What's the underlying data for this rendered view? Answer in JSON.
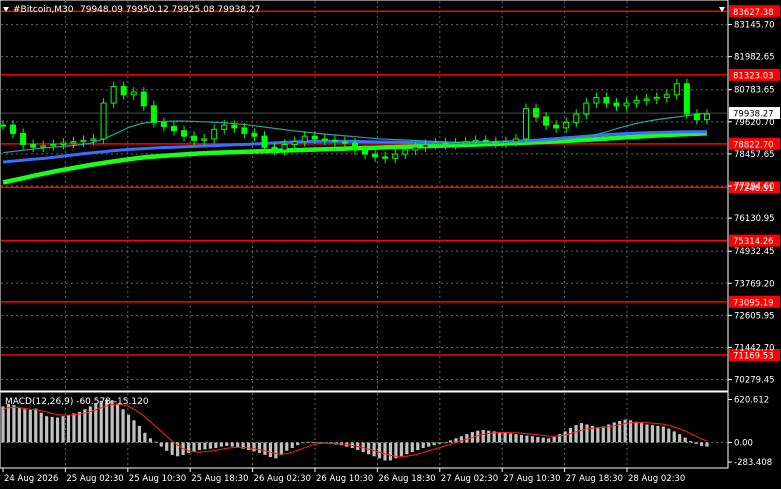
{
  "header": {
    "symbol": "#Bitcoin,M30",
    "ohlc": "79948.09 79950.12 79925.08 79938.27"
  },
  "colors": {
    "background": "#000000",
    "grid": "#5a6c5a",
    "axis_text": "#ffffff",
    "level_line": "#ff0000",
    "level_label_bg": "#ff0000",
    "candle": "#00ff00",
    "ma_fast": "#2aa0a0",
    "ma_mid": "#3b6cff",
    "ma_slow": "#19ff19",
    "macd_hist": "#c0c0c0",
    "macd_signal": "#ff2020",
    "price_label_bg": "#ffffff"
  },
  "chart_data": [
    {
      "type": "line",
      "panel": "price",
      "ylim": [
        69900,
        84000
      ],
      "y_ticks": [
        83145.7,
        81982.65,
        80783.65,
        79620.7,
        78457.65,
        77294.6,
        76130.95,
        74932.45,
        73769.2,
        72605.95,
        71442.7,
        70279.45
      ],
      "y_tick_labels": [
        "83145.70",
        "81982.65",
        "80783.65",
        "79620.70",
        "78457.65",
        "77294.60",
        "76130.95",
        "74932.45",
        "73769.20",
        "72605.95",
        "71442.70",
        "70279.45"
      ],
      "x_labels": [
        "24 Aug 2026",
        "25 Aug 02:30",
        "25 Aug 10:30",
        "25 Aug 18:30",
        "26 Aug 02:30",
        "26 Aug 10:30",
        "26 Aug 18:30",
        "27 Aug 02:30",
        "27 Aug 10:30",
        "27 Aug 18:30",
        "28 Aug 02:30"
      ],
      "levels": [
        {
          "value": 83627.38,
          "label": "83627.38"
        },
        {
          "value": 81323.03,
          "label": "81323.03"
        },
        {
          "value": 78822.7,
          "label": "78822.70"
        },
        {
          "value": 77246.51,
          "label": "77246.51"
        },
        {
          "value": 75314.26,
          "label": "75314.26"
        },
        {
          "value": 73095.19,
          "label": "73095.19"
        },
        {
          "value": 71169.53,
          "label": "71169.53"
        }
      ],
      "current_price": {
        "value": 79938.27,
        "label": "79938.27"
      },
      "price_series": [
        79500,
        79200,
        78800,
        78700,
        78750,
        78800,
        78850,
        78900,
        78950,
        79000,
        80300,
        80900,
        80600,
        80700,
        80200,
        79600,
        79450,
        79300,
        79100,
        78950,
        79000,
        79350,
        79500,
        79400,
        79200,
        79100,
        78700,
        78600,
        78800,
        78900,
        79100,
        79000,
        78950,
        78900,
        78850,
        78600,
        78450,
        78350,
        78300,
        78450,
        78600,
        78700,
        78800,
        78850,
        78800,
        78850,
        78900,
        78950,
        78900,
        78850,
        78900,
        79000,
        80100,
        79800,
        79500,
        79400,
        79600,
        79900,
        80300,
        80500,
        80300,
        80200,
        80300,
        80400,
        80450,
        80500,
        80600,
        81000,
        79900,
        79700,
        79900
      ],
      "series": [
        {
          "values": [
            78500,
            78560,
            78610,
            78660,
            78700,
            78740,
            78780,
            78850,
            79000,
            79200,
            79420,
            79560,
            79620,
            79640,
            79650,
            79640,
            79620,
            79600,
            79570,
            79530,
            79480,
            79420,
            79360,
            79300,
            79250,
            79200,
            79160,
            79120,
            79080,
            79040,
            79000,
            78980,
            78960,
            78940,
            78920,
            78900,
            78880,
            78870,
            78860,
            78860,
            78870,
            78880,
            78900,
            78930,
            78960,
            79000,
            79060,
            79140,
            79260,
            79400,
            79520,
            79620,
            79700,
            79760,
            79820,
            79880,
            79930
          ]
        },
        {
          "values": [
            78160,
            78210,
            78260,
            78300,
            78360,
            78420,
            78480,
            78530,
            78580,
            78620,
            78650,
            78680,
            78700,
            78720,
            78740,
            78760,
            78780,
            78800,
            78820,
            78850,
            78880,
            78900,
            78910,
            78915,
            78915,
            78910,
            78900,
            78890,
            78880,
            78870,
            78860,
            78850,
            78850,
            78860,
            78870,
            78880,
            78900,
            78930,
            78960,
            79000,
            79040,
            79080,
            79120,
            79160,
            79190,
            79210,
            79230,
            79245,
            79255,
            79260,
            79265
          ]
        },
        {
          "values": [
            77420,
            77560,
            77700,
            77830,
            77950,
            78060,
            78160,
            78250,
            78330,
            78380,
            78430,
            78470,
            78500,
            78520,
            78540,
            78560,
            78580,
            78600,
            78620,
            78640,
            78660,
            78680,
            78700,
            78720,
            78740,
            78760,
            78780,
            78800,
            78820,
            78845,
            78870,
            78900,
            78930,
            78960,
            79000,
            79040,
            79080,
            79120,
            79150,
            79180,
            79200
          ]
        }
      ]
    },
    {
      "type": "bar",
      "panel": "macd",
      "title": "MACD(12,26,9) -60.578 -15.120",
      "ylim": [
        -340,
        700
      ],
      "y_tick_labels": [
        "620.612",
        "0.00",
        "-283.408"
      ],
      "y_ticks": [
        620.612,
        0,
        -283.408
      ],
      "values": [
        520,
        560,
        540,
        500,
        480,
        470,
        490,
        430,
        380,
        370,
        360,
        380,
        400,
        420,
        440,
        480,
        520,
        560,
        600,
        620,
        610,
        560,
        480,
        400,
        320,
        240,
        140,
        60,
        10,
        -60,
        -120,
        -180,
        -200,
        -180,
        -150,
        -130,
        -110,
        -100,
        -90,
        -80,
        -60,
        -50,
        -60,
        -70,
        -90,
        -110,
        -130,
        -150,
        -180,
        -210,
        -230,
        -180,
        -120,
        -80,
        -40,
        0,
        10,
        5,
        0,
        -10,
        -20,
        -30,
        -40,
        -60,
        -80,
        -110,
        -140,
        -170,
        -200,
        -230,
        -260,
        -260,
        -230,
        -200,
        -170,
        -140,
        -110,
        -80,
        -60,
        -40,
        -20,
        0,
        30,
        60,
        90,
        120,
        150,
        170,
        180,
        170,
        160,
        150,
        140,
        130,
        120,
        110,
        100,
        90,
        80,
        70,
        60,
        80,
        120,
        160,
        210,
        250,
        280,
        260,
        240,
        220,
        230,
        260,
        290,
        310,
        330,
        320,
        300,
        280,
        260,
        250,
        240,
        230,
        200,
        160,
        120,
        70,
        20,
        -20,
        -50,
        -60
      ],
      "signal": [
        480,
        500,
        510,
        500,
        490,
        480,
        475,
        460,
        440,
        420,
        400,
        395,
        395,
        400,
        410,
        425,
        445,
        470,
        500,
        530,
        550,
        555,
        545,
        520,
        480,
        430,
        370,
        300,
        230,
        160,
        90,
        20,
        -40,
        -90,
        -120,
        -135,
        -140,
        -135,
        -125,
        -115,
        -100,
        -85,
        -75,
        -70,
        -72,
        -80,
        -92,
        -105,
        -120,
        -140,
        -160,
        -170,
        -160,
        -140,
        -115,
        -85,
        -55,
        -30,
        -15,
        -10,
        -12,
        -16,
        -22,
        -30,
        -42,
        -58,
        -76,
        -96,
        -118,
        -142,
        -166,
        -186,
        -198,
        -202,
        -198,
        -186,
        -168,
        -146,
        -122,
        -98,
        -74,
        -50,
        -26,
        0,
        24,
        48,
        72,
        96,
        116,
        130,
        140,
        144,
        145,
        143,
        140,
        135,
        128,
        120,
        110,
        100,
        92,
        90,
        95,
        108,
        128,
        152,
        178,
        196,
        206,
        210,
        216,
        226,
        240,
        256,
        272,
        284,
        290,
        290,
        286,
        280,
        272,
        262,
        246,
        224,
        196,
        164,
        128,
        90,
        52,
        20
      ]
    }
  ]
}
